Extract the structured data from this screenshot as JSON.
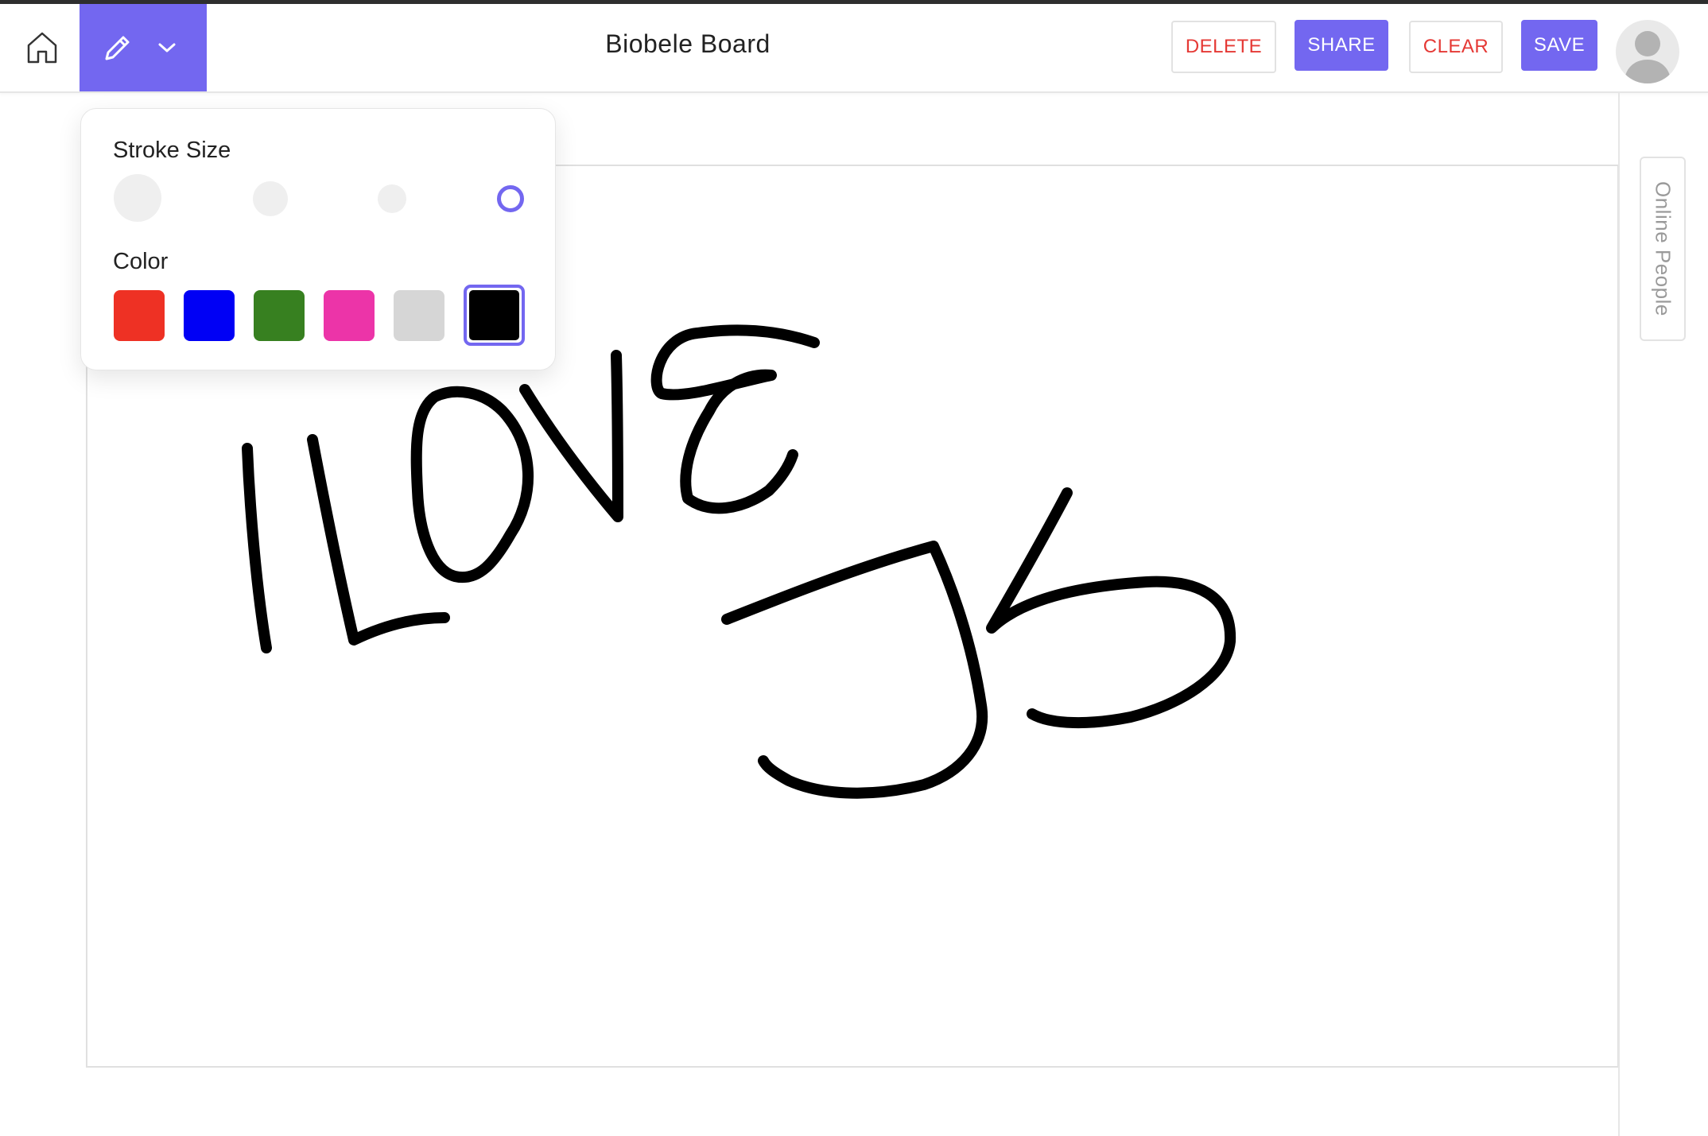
{
  "header": {
    "title": "Biobele Board",
    "delete_label": "DELETE",
    "share_label": "SHARE",
    "clear_label": "CLEAR",
    "save_label": "SAVE"
  },
  "tool": {
    "active": "pencil-icon",
    "dropdown_icon": "chevron-down-icon"
  },
  "popover": {
    "stroke_label": "Stroke Size",
    "color_label": "Color",
    "stroke_sizes": [
      "extra-large",
      "large",
      "medium",
      "small"
    ],
    "selected_stroke": "small",
    "colors": [
      "#ee3124",
      "#0000f5",
      "#378020",
      "#ec34a8",
      "#d6d6d6",
      "#000000"
    ],
    "selected_color": "#000000"
  },
  "sidebar": {
    "online_label": "Online People"
  },
  "canvas": {
    "drawing_text": "I LOVE JS",
    "stroke_color": "#000000"
  },
  "colors": {
    "accent": "#7367f0",
    "danger": "#e53935"
  }
}
